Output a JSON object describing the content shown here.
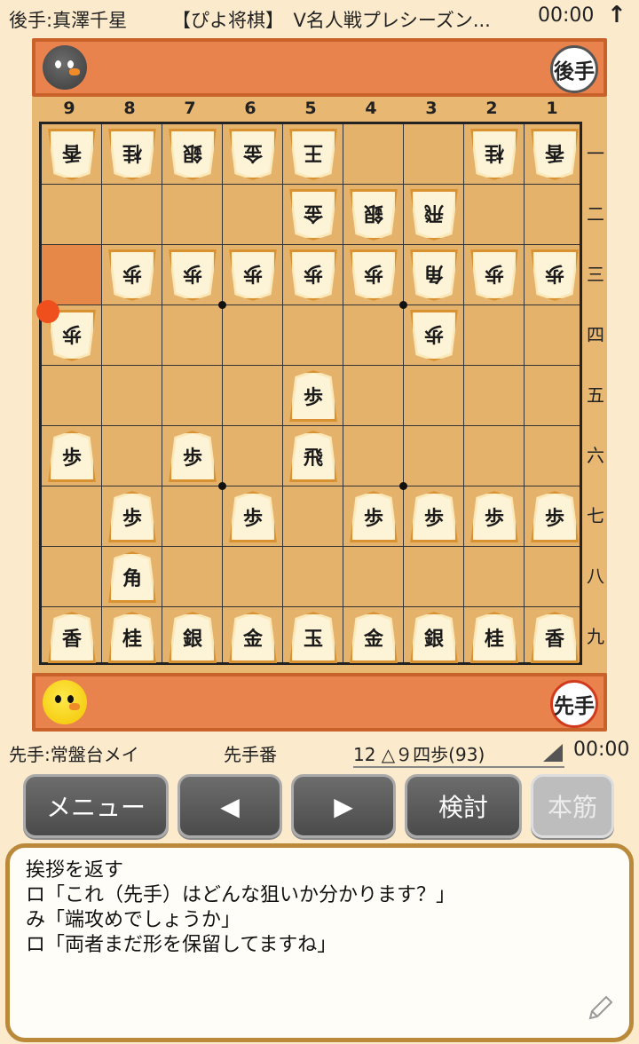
{
  "header": {
    "gote_player": "後手:真澤千星",
    "match_title": "【ぴよ将棋】　V名人戦プレシーズン...",
    "gote_clock": "00:00",
    "arrow_icon": "up-arrow-icon",
    "arrow_glyph": "↑"
  },
  "gote_stand": {
    "badge": "後手",
    "avatar_icon": "black-chick-avatar-icon"
  },
  "sente_stand": {
    "badge": "先手",
    "avatar_icon": "yellow-chick-avatar-icon"
  },
  "board": {
    "file_labels": [
      "9",
      "8",
      "7",
      "6",
      "5",
      "4",
      "3",
      "2",
      "1"
    ],
    "rank_labels": [
      "一",
      "二",
      "三",
      "四",
      "五",
      "六",
      "七",
      "八",
      "九"
    ],
    "pieces": [
      {
        "file": 9,
        "rank": 1,
        "kind": "香",
        "side": "gote"
      },
      {
        "file": 8,
        "rank": 1,
        "kind": "桂",
        "side": "gote"
      },
      {
        "file": 7,
        "rank": 1,
        "kind": "銀",
        "side": "gote"
      },
      {
        "file": 6,
        "rank": 1,
        "kind": "金",
        "side": "gote"
      },
      {
        "file": 5,
        "rank": 1,
        "kind": "王",
        "side": "gote"
      },
      {
        "file": 2,
        "rank": 1,
        "kind": "桂",
        "side": "gote"
      },
      {
        "file": 1,
        "rank": 1,
        "kind": "香",
        "side": "gote"
      },
      {
        "file": 5,
        "rank": 2,
        "kind": "金",
        "side": "gote"
      },
      {
        "file": 4,
        "rank": 2,
        "kind": "銀",
        "side": "gote"
      },
      {
        "file": 3,
        "rank": 2,
        "kind": "飛",
        "side": "gote"
      },
      {
        "file": 8,
        "rank": 3,
        "kind": "歩",
        "side": "gote"
      },
      {
        "file": 7,
        "rank": 3,
        "kind": "歩",
        "side": "gote"
      },
      {
        "file": 6,
        "rank": 3,
        "kind": "歩",
        "side": "gote"
      },
      {
        "file": 5,
        "rank": 3,
        "kind": "歩",
        "side": "gote"
      },
      {
        "file": 4,
        "rank": 3,
        "kind": "歩",
        "side": "gote"
      },
      {
        "file": 3,
        "rank": 3,
        "kind": "角",
        "side": "gote"
      },
      {
        "file": 2,
        "rank": 3,
        "kind": "歩",
        "side": "gote"
      },
      {
        "file": 1,
        "rank": 3,
        "kind": "歩",
        "side": "gote"
      },
      {
        "file": 9,
        "rank": 4,
        "kind": "歩",
        "side": "gote"
      },
      {
        "file": 3,
        "rank": 4,
        "kind": "歩",
        "side": "gote"
      },
      {
        "file": 5,
        "rank": 5,
        "kind": "歩",
        "side": "sente"
      },
      {
        "file": 9,
        "rank": 6,
        "kind": "歩",
        "side": "sente"
      },
      {
        "file": 7,
        "rank": 6,
        "kind": "歩",
        "side": "sente"
      },
      {
        "file": 5,
        "rank": 6,
        "kind": "飛",
        "side": "sente"
      },
      {
        "file": 8,
        "rank": 7,
        "kind": "歩",
        "side": "sente"
      },
      {
        "file": 6,
        "rank": 7,
        "kind": "歩",
        "side": "sente"
      },
      {
        "file": 4,
        "rank": 7,
        "kind": "歩",
        "side": "sente"
      },
      {
        "file": 3,
        "rank": 7,
        "kind": "歩",
        "side": "sente"
      },
      {
        "file": 2,
        "rank": 7,
        "kind": "歩",
        "side": "sente"
      },
      {
        "file": 1,
        "rank": 7,
        "kind": "歩",
        "side": "sente"
      },
      {
        "file": 8,
        "rank": 8,
        "kind": "角",
        "side": "sente"
      },
      {
        "file": 9,
        "rank": 9,
        "kind": "香",
        "side": "sente"
      },
      {
        "file": 8,
        "rank": 9,
        "kind": "桂",
        "side": "sente"
      },
      {
        "file": 7,
        "rank": 9,
        "kind": "銀",
        "side": "sente"
      },
      {
        "file": 6,
        "rank": 9,
        "kind": "金",
        "side": "sente"
      },
      {
        "file": 5,
        "rank": 9,
        "kind": "玉",
        "side": "sente"
      },
      {
        "file": 4,
        "rank": 9,
        "kind": "金",
        "side": "sente"
      },
      {
        "file": 3,
        "rank": 9,
        "kind": "銀",
        "side": "sente"
      },
      {
        "file": 2,
        "rank": 9,
        "kind": "桂",
        "side": "sente"
      },
      {
        "file": 1,
        "rank": 9,
        "kind": "香",
        "side": "sente"
      }
    ],
    "last_move_from": {
      "file": 9,
      "rank": 3
    },
    "last_move_to": {
      "file": 9,
      "rank": 4
    },
    "colors": {
      "highlight": "#e57b3c",
      "marker": "#ee4f1c"
    }
  },
  "status": {
    "sente_player": "先手:常盤台メイ",
    "turn": "先手番",
    "move_record": "12 △９四歩(93)",
    "sente_clock": "00:00"
  },
  "buttons": {
    "menu": "メニュー",
    "prev": "◀",
    "next": "▶",
    "study": "検討",
    "mainline": "本筋"
  },
  "comment": {
    "lines": [
      "挨拶を返す",
      "ロ「これ（先手）はどんな狙いか分かります？」",
      "み「端攻めでしょうか」",
      "ロ「両者まだ形を保留してますね」"
    ],
    "edit_icon": "pencil-icon"
  }
}
